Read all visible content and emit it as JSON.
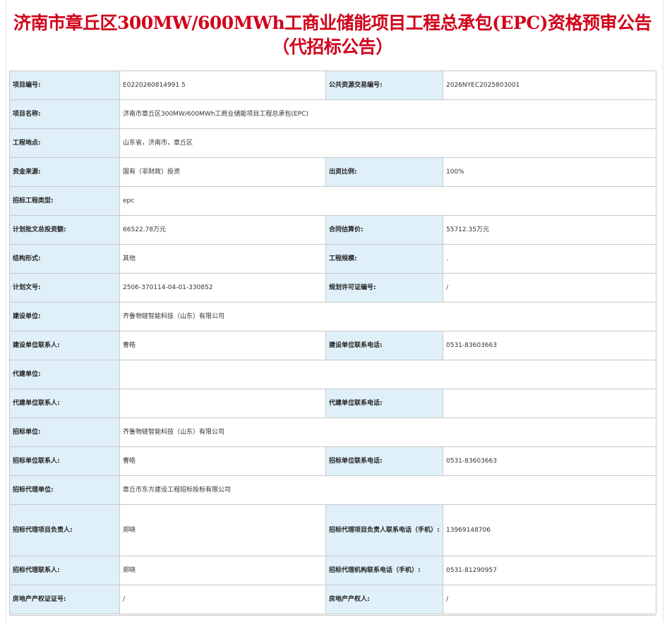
{
  "title": "济南市章丘区300MW/600MWh工商业储能项目工程总承包(EPC)资格预审公告（代招标公告）",
  "rows": [
    {
      "l1": "项目编号:",
      "v1": "E0220260814991 5",
      "l2": "公共资源交易编号:",
      "v2": "2026NYEC2025803001"
    },
    {
      "l1": "项目名称:",
      "v1": "济南市章丘区300MW/600MWh工商业储能项目工程总承包(EPC)"
    },
    {
      "l1": "工程地点:",
      "v1": "山东省，济南市，章丘区"
    },
    {
      "l1": "资金来源:",
      "v1": "国有（非财政）投资",
      "l2": "出资比例:",
      "v2": "100%"
    },
    {
      "l1": "招标工程类型:",
      "v1": "epc"
    },
    {
      "l1": "计划批文总投资额:",
      "v1": "66522.78万元",
      "l2": "合同估算价:",
      "v2": "55712.35万元"
    },
    {
      "l1": "结构形式:",
      "v1": "其他",
      "l2": "工程规模:",
      "v2": "."
    },
    {
      "l1": "计划文号:",
      "v1": "2506-370114-04-01-330852",
      "l2": "规划许可证编号:",
      "v2": "/"
    },
    {
      "l1": "建设单位:",
      "v1": "齐鲁物链智能科技（山东）有限公司"
    },
    {
      "l1": "建设单位联系人:",
      "v1": "曹皓",
      "l2": "建设单位联系电话:",
      "v2": "0531-83603663"
    },
    {
      "l1": "代建单位:",
      "v1": ""
    },
    {
      "l1": "代建单位联系人:",
      "v1": "",
      "l2": "代建单位联系电话:",
      "v2": ""
    },
    {
      "l1": "招标单位:",
      "v1": "齐鲁物链智能科技（山东）有限公司"
    },
    {
      "l1": "招标单位联系人:",
      "v1": "曹皓",
      "l2": "招标单位联系电话:",
      "v2": "0531-83603663"
    },
    {
      "l1": "招标代理单位:",
      "v1": "章丘市东方建设工程招标投标有限公司"
    },
    {
      "l1": "招标代理项目负责人:",
      "v1": "郑晓",
      "l2": "招标代理项目负责人联系电话（手机）:",
      "v2": "13969148706"
    },
    {
      "l1": "招标代理联系人:",
      "v1": "郑晓",
      "l2": "招标代理机构联系电话（手机）:",
      "v2": "0531-81290957"
    },
    {
      "l1": "房地产产权证证号:",
      "v1": "/",
      "l2": "房地产产权人:",
      "v2": "/"
    }
  ]
}
